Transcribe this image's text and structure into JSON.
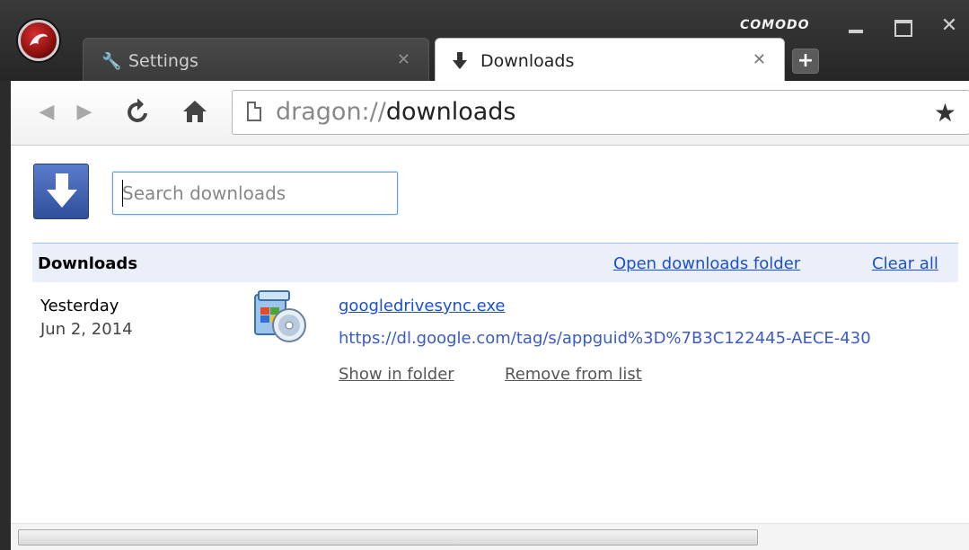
{
  "window": {
    "brand": "COMODO"
  },
  "tabs": [
    {
      "label": "Settings",
      "icon": "wrench-icon",
      "active": false
    },
    {
      "label": "Downloads",
      "icon": "download-arrow-icon",
      "active": true
    }
  ],
  "toolbar": {
    "url_scheme": "dragon://",
    "url_path": "downloads"
  },
  "page": {
    "search_placeholder": "Search downloads",
    "section_title": "Downloads",
    "open_folder_link": "Open downloads folder",
    "clear_all_link": "Clear all"
  },
  "downloads": [
    {
      "date_label": "Yesterday",
      "date": "Jun 2, 2014",
      "file_name": "googledrivesync.exe",
      "url": "https://dl.google.com/tag/s/appguid%3D%7B3C122445-AECE-430",
      "show_in_folder": "Show in folder",
      "remove_from_list": "Remove from list"
    }
  ],
  "colors": {
    "link": "#1a4fd6",
    "header_bar": "#ebeff9",
    "titlebar": "#2b2b2b"
  }
}
